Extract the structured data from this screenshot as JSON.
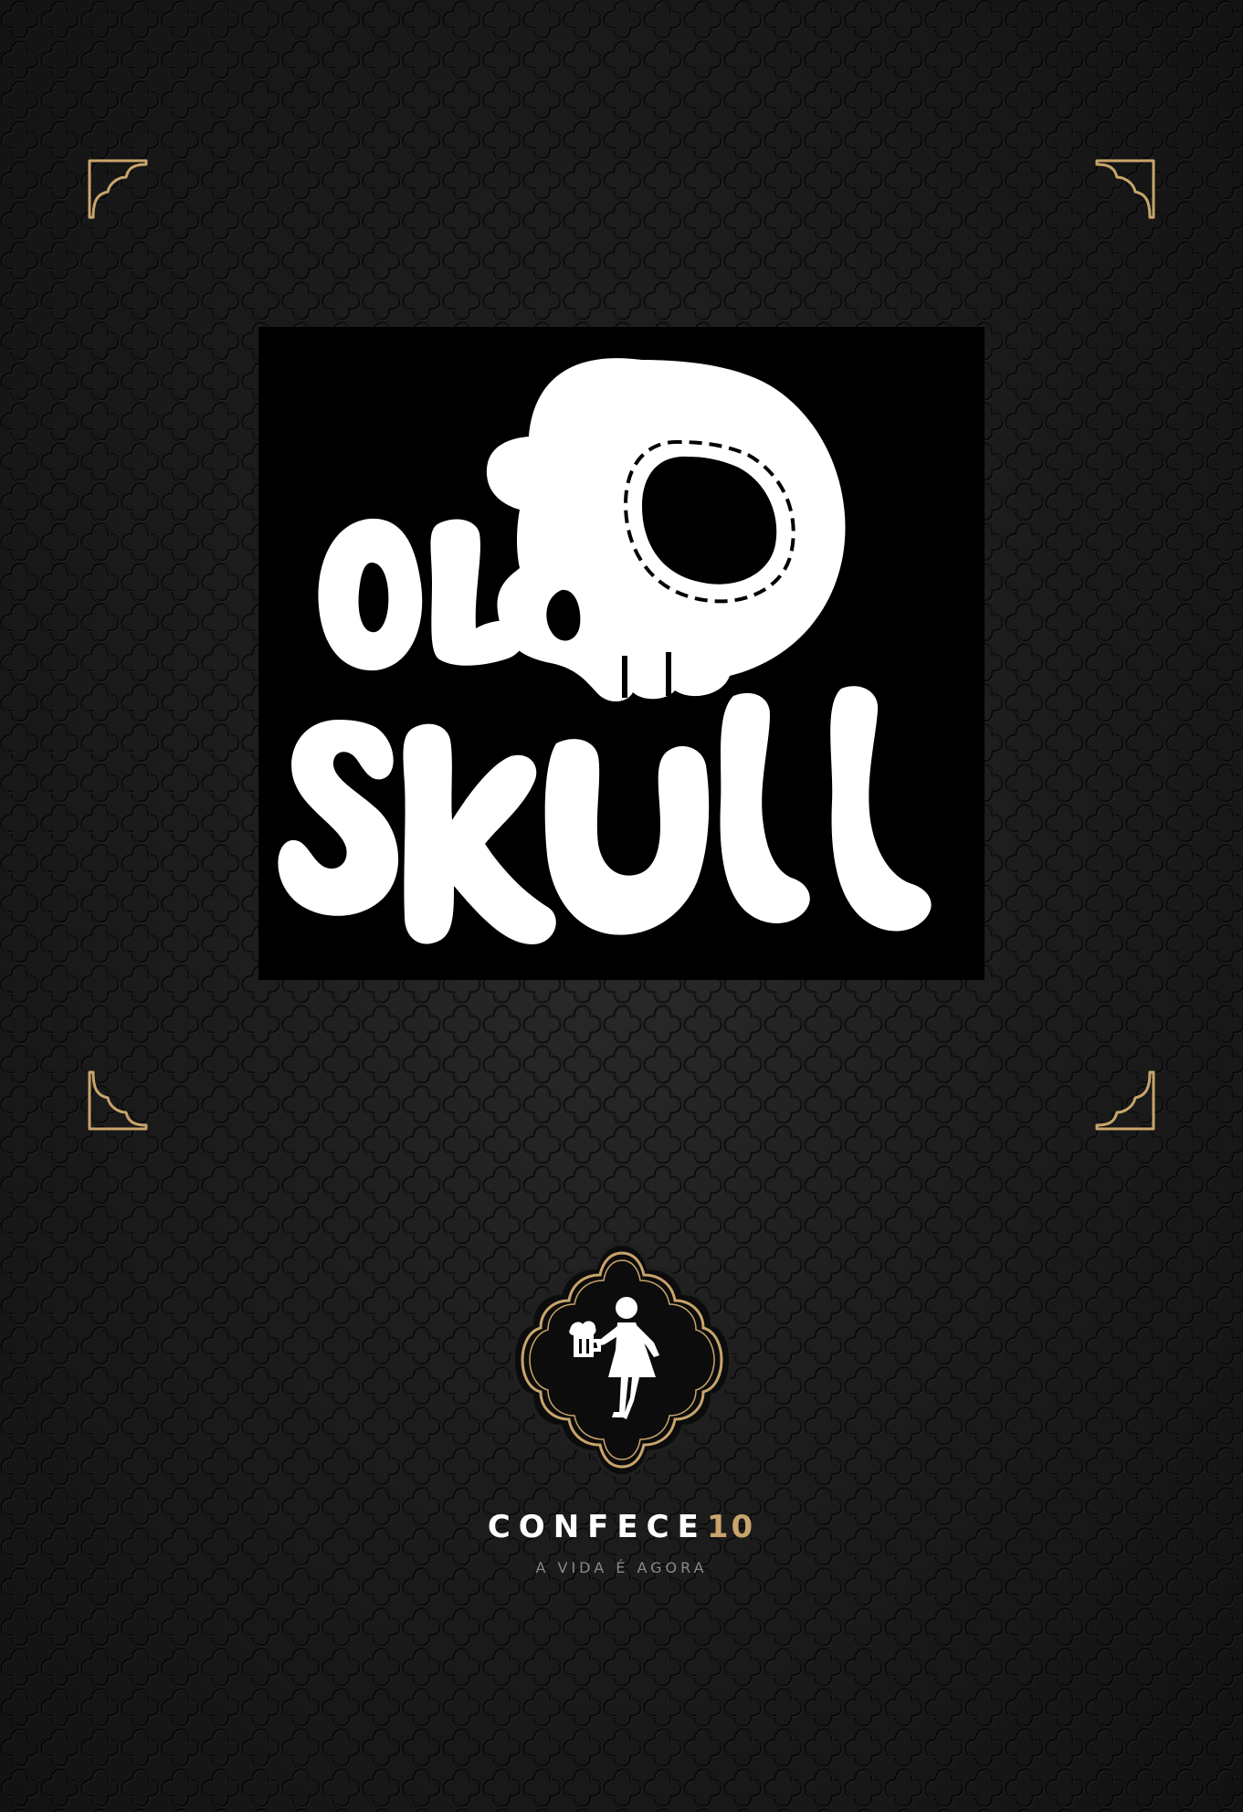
{
  "logo": {
    "line1": "OLD",
    "line2": "SKULL"
  },
  "brand": {
    "name": "CONFECE",
    "number": "10",
    "tagline": "A VIDA É AGORA"
  },
  "colors": {
    "background": "#151515",
    "gold": "#c9a46c",
    "white": "#ffffff",
    "tagline_gray": "#8a8a8a"
  },
  "icons": [
    "corner-ornament-icon",
    "old-skull-logo",
    "woman-with-beer-icon"
  ]
}
